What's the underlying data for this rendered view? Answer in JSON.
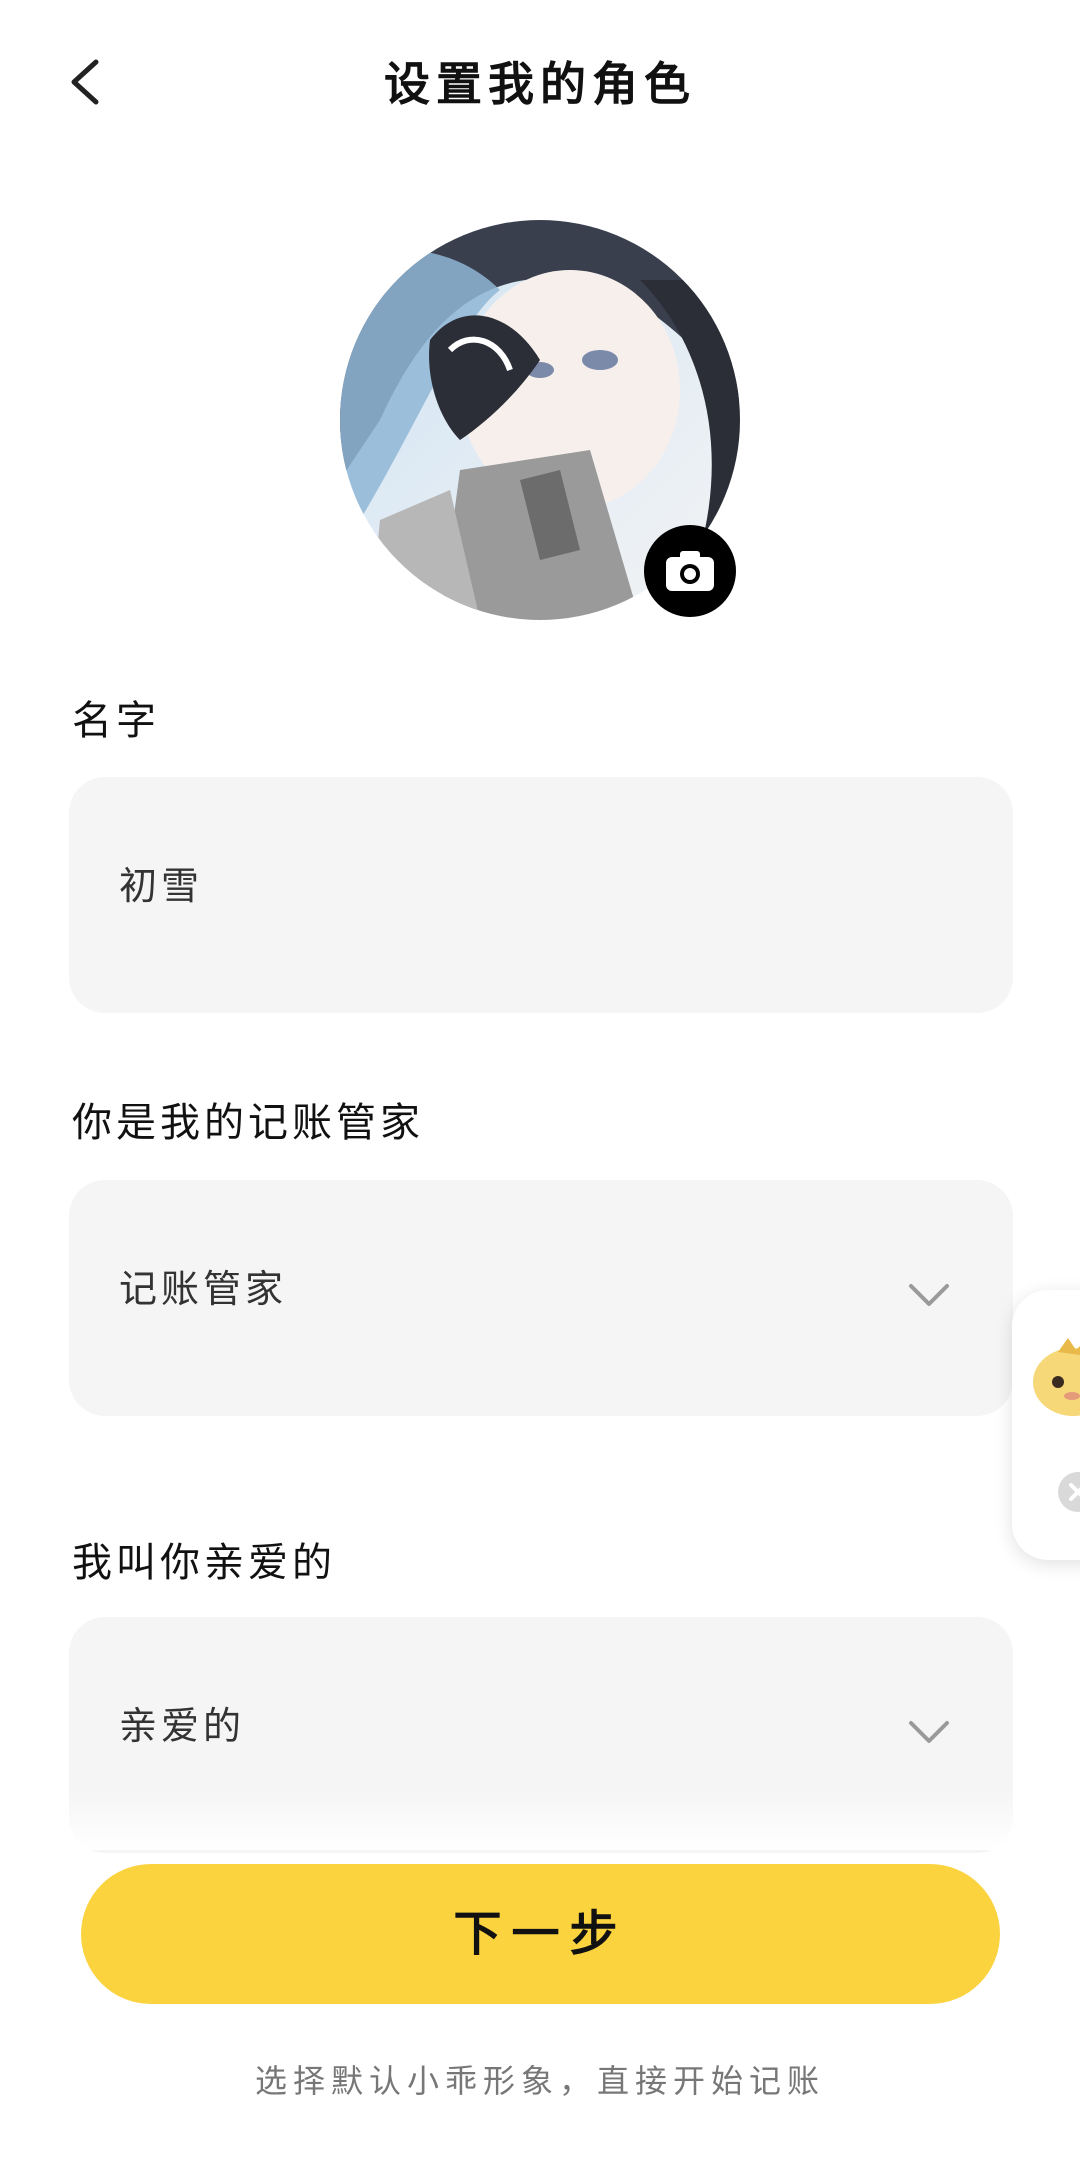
{
  "header": {
    "title": "设置我的角色"
  },
  "form": {
    "name_label": "名字",
    "name_value": "初雪",
    "role_label": "你是我的记账管家",
    "role_value": "记账管家",
    "callname_label": "我叫你亲爱的",
    "callname_value": "亲爱的"
  },
  "actions": {
    "next_label": "下一步",
    "default_link": "选择默认小乖形象，直接开始记账"
  },
  "colors": {
    "accent": "#fbd33f",
    "field_bg": "#f5f5f5",
    "chevron": "#9a9a9a"
  },
  "icons": [
    "back-arrow-icon",
    "camera-icon",
    "chevron-down-icon",
    "mascot-icon",
    "close-icon"
  ]
}
